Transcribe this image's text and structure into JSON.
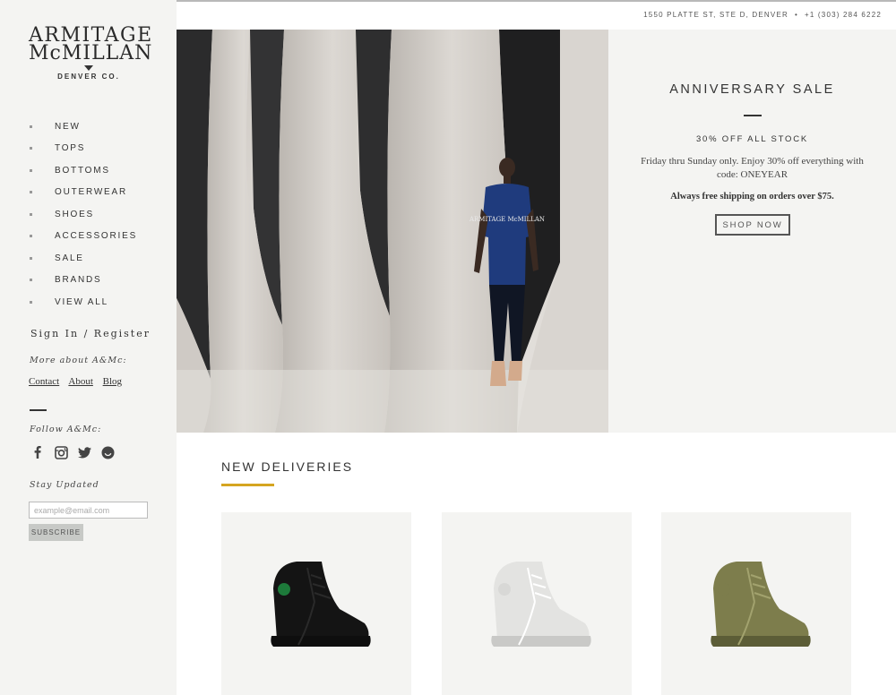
{
  "brand": {
    "line1": "ARMITAGE",
    "line2": "McMILLAN",
    "line3": "DENVER CO."
  },
  "topbar": {
    "address": "1550 PLATTE ST, STE D, DENVER",
    "separator": "•",
    "phone": "+1 (303) 284 6222",
    "icons": [
      "search-icon",
      "cart-icon"
    ]
  },
  "nav": {
    "items": [
      "NEW",
      "TOPS",
      "BOTTOMS",
      "OUTERWEAR",
      "SHOES",
      "ACCESSORIES",
      "SALE",
      "BRANDS",
      "VIEW ALL"
    ]
  },
  "account": {
    "signin": "Sign In / Register",
    "more_heading": "More about A&Mc:",
    "links": [
      "Contact",
      "About",
      "Blog"
    ],
    "follow_heading": "Follow A&Mc:",
    "social_icons": [
      "facebook-icon",
      "instagram-icon",
      "twitter-icon",
      "smile-icon"
    ],
    "stay_heading": "Stay Updated",
    "email_placeholder": "example@email.com",
    "subscribe_label": "SUBSCRIBE"
  },
  "hero": {
    "title": "ANNIVERSARY SALE",
    "subtitle": "30% OFF ALL STOCK",
    "description": "Friday thru Sunday only. Enjoy 30% off everything with code: ONEYEAR",
    "shipping": "Always free shipping on orders over $75.",
    "button_label": "SHOP NOW",
    "shirt_text": "ARMITAGE McMILLAN"
  },
  "deliveries": {
    "title": "NEW DELIVERIES",
    "products": [
      {
        "color": "#141414",
        "sole": "#0e0e0e",
        "accent": "#1d7a3a",
        "lace": "#2a2a2a"
      },
      {
        "color": "#e3e3e1",
        "sole": "#c9c9c7",
        "accent": "#d8d8d6",
        "lace": "#ffffff"
      },
      {
        "color": "#7d7d4c",
        "sole": "#5c5d37",
        "accent": "#7d7d4c",
        "lace": "#a2a26e"
      }
    ]
  },
  "colors": {
    "accent": "#d5a521",
    "sidebar_bg": "#f4f4f2",
    "text": "#333333"
  }
}
